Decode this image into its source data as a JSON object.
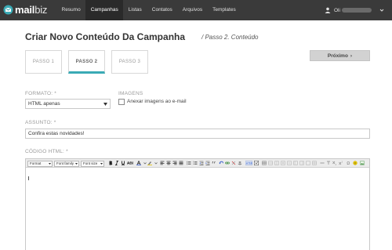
{
  "app": {
    "logo_primary": "mail",
    "logo_secondary": "biz"
  },
  "nav": {
    "items": [
      {
        "label": "Resumo"
      },
      {
        "label": "Campanhas"
      },
      {
        "label": "Listas"
      },
      {
        "label": "Contatos"
      },
      {
        "label": "Arquivos"
      },
      {
        "label": "Templates"
      }
    ],
    "active_index": 1
  },
  "user": {
    "name": "Oli"
  },
  "page": {
    "title": "Criar Novo Conteúdo Da Campanha",
    "subtitle": "/ Passo 2. Conteúdo"
  },
  "steps": [
    {
      "label": "PASSO 1"
    },
    {
      "label": "PASSO 2"
    },
    {
      "label": "PASSO 3"
    }
  ],
  "next_button": {
    "label": "Próximo",
    "arrow": "›"
  },
  "form": {
    "format_label": "FORMATO: *",
    "format_value": "HTML apenas",
    "images_label": "IMAGENS",
    "attach_images_label": "Anexar imagens ao e-mail",
    "subject_label": "ASSUNTO: *",
    "subject_value": "Confira estas novidades!",
    "html_code_label": "CÓDIGO HTML: *"
  },
  "editor_toolbar": {
    "format": "Format",
    "font_family": "Font family",
    "font_size": "Font size"
  },
  "colors": {
    "topbar": "#3a3a3a",
    "accent": "#3aaab5",
    "logo_icon": "#3aaab5",
    "next_button_bg": "#d2d2d2"
  },
  "icons": {
    "logo": "envelope-logo-icon",
    "user": "user-icon",
    "caret": "chevron-down-icon",
    "next": "chevron-right-icon"
  }
}
